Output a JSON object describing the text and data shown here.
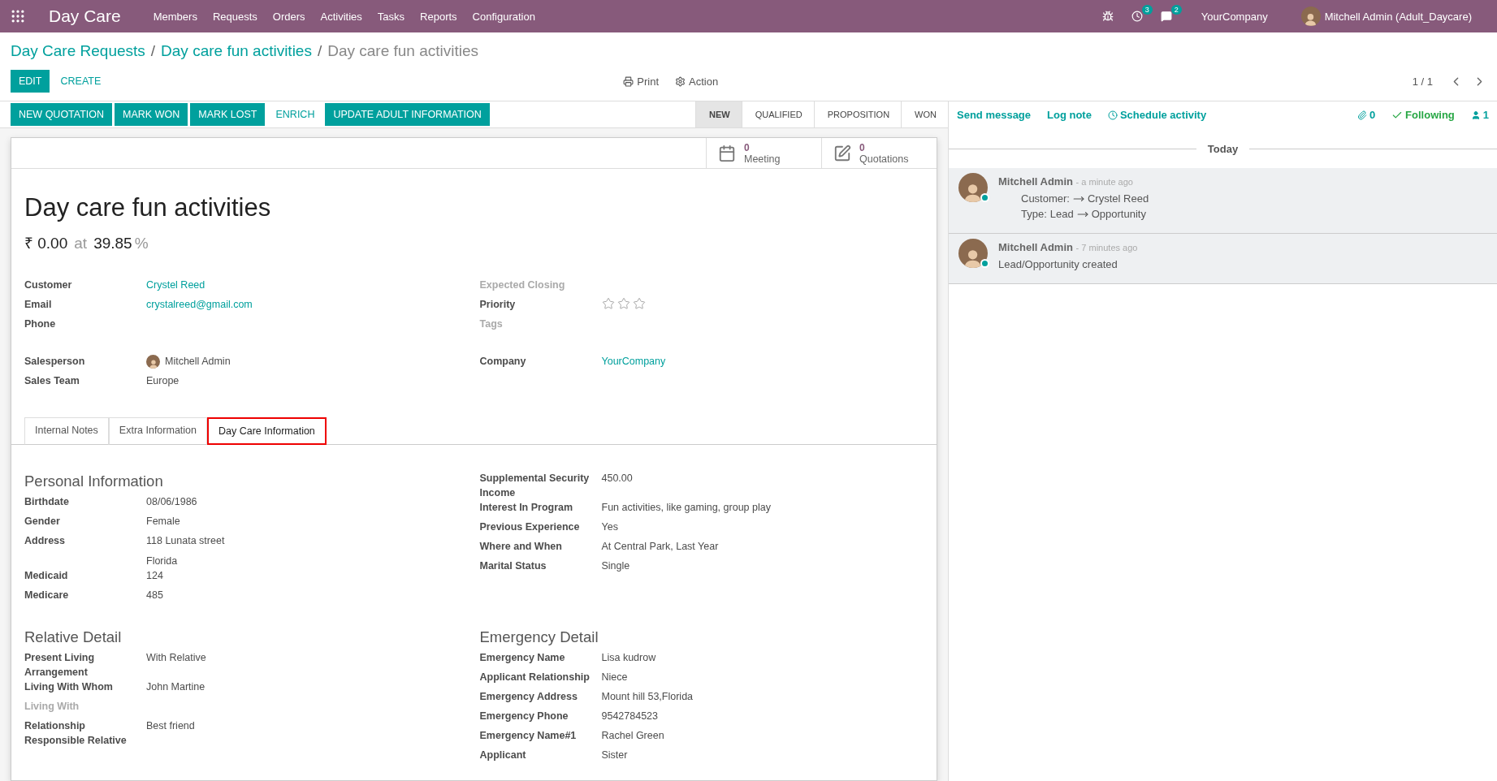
{
  "navbar": {
    "brand": "Day Care",
    "menu": [
      "Members",
      "Requests",
      "Orders",
      "Activities",
      "Tasks",
      "Reports",
      "Configuration"
    ],
    "activity_count": "3",
    "message_count": "2",
    "company": "YourCompany",
    "user": "Mitchell Admin (Adult_Daycare)"
  },
  "breadcrumbs": [
    {
      "label": "Day Care Requests",
      "link": true
    },
    {
      "separator": "/",
      "label": "Day care fun activities",
      "link": true
    },
    {
      "separator": "/",
      "label": "Day care fun activities",
      "link": false
    }
  ],
  "control_panel": {
    "buttons": [
      {
        "label": "EDIT",
        "kind": "primary"
      },
      {
        "label": "CREATE",
        "kind": "link"
      }
    ],
    "print": "Print",
    "action": "Action",
    "pager": "1 / 1"
  },
  "header_buttons": [
    {
      "label": "NEW QUOTATION",
      "kind": "primary"
    },
    {
      "label": "MARK WON",
      "kind": "primary"
    },
    {
      "label": "MARK LOST",
      "kind": "primary"
    },
    {
      "label": "ENRICH",
      "kind": "link"
    },
    {
      "label": "UPDATE ADULT INFORMATION",
      "kind": "primary"
    }
  ],
  "stages": [
    {
      "label": "NEW",
      "selected": true
    },
    {
      "label": "QUALIFIED",
      "selected": false
    },
    {
      "label": "PROPOSITION",
      "selected": false
    },
    {
      "label": "WON",
      "selected": false
    }
  ],
  "smart_buttons": [
    {
      "kind": "calendar",
      "count": "0",
      "label": "Meeting"
    },
    {
      "kind": "edit",
      "count": "0",
      "label": "Quotations"
    }
  ],
  "title": "Day care fun activities",
  "revenue": {
    "amount": "₹ 0.00",
    "at": "at",
    "probability": "39.85",
    "unit": "%"
  },
  "main_fields": [
    [
      {
        "label": "Customer",
        "value": "Crystel Reed",
        "kind": "link",
        "muted": false
      },
      {
        "label": "Email",
        "value": "crystalreed@gmail.com",
        "kind": "link",
        "muted": false
      },
      {
        "label": "Phone",
        "kind": "text",
        "muted": false
      },
      {
        "kind": "gap"
      },
      {
        "label": "Salesperson",
        "value": "Mitchell Admin",
        "kind": "avatar",
        "muted": false
      },
      {
        "label": "Sales Team",
        "value": "Europe",
        "kind": "text",
        "muted": false
      }
    ],
    [
      {
        "label": "Expected Closing",
        "kind": "text",
        "muted": true
      },
      {
        "label": "Priority",
        "kind": "stars",
        "stars": 0,
        "muted": false
      },
      {
        "label": "Tags",
        "kind": "text",
        "muted": true
      },
      {
        "kind": "gap"
      },
      {
        "label": "Company",
        "value": "YourCompany",
        "kind": "link",
        "muted": false
      }
    ]
  ],
  "tabs": [
    {
      "label": "Internal Notes",
      "selected": false
    },
    {
      "label": "Extra Information",
      "selected": false
    },
    {
      "label": "Day Care Information",
      "selected": true
    }
  ],
  "sections": [
    {
      "title": "Personal Information",
      "rows": [
        {
          "label": "Birthdate",
          "values": [
            "08/06/1986"
          ]
        },
        {
          "label": "Gender",
          "values": [
            "Female"
          ]
        },
        {
          "label": "Address",
          "values": [
            "118 Lunata street",
            "Florida"
          ]
        },
        {
          "label": "Medicaid",
          "values": [
            "124"
          ]
        },
        {
          "label": "Medicare",
          "values": [
            "485"
          ]
        }
      ]
    },
    {
      "rows": [
        {
          "label": "Supplemental Security Income",
          "values": [
            "450.00"
          ]
        },
        {
          "label": "Interest In Program",
          "values": [
            "Fun activities, like gaming, group play"
          ]
        },
        {
          "label": "Previous Experience",
          "values": [
            "Yes"
          ]
        },
        {
          "label": "Where and When",
          "values": [
            "At Central Park, Last Year"
          ]
        },
        {
          "label": "Marital Status",
          "values": [
            "Single"
          ]
        }
      ]
    },
    {
      "title": "Relative Detail",
      "rows": [
        {
          "label": "Present Living Arrangement",
          "values": [
            "With Relative"
          ]
        },
        {
          "label": "Living With Whom",
          "values": [
            "John Martine"
          ]
        },
        {
          "label": "Living With",
          "values": [],
          "muted": true
        },
        {
          "label": "Relationship Responsible Relative",
          "values": [
            "Best friend"
          ]
        }
      ]
    },
    {
      "title": "Emergency Detail",
      "rows": [
        {
          "label": "Emergency Name",
          "values": [
            "Lisa kudrow"
          ]
        },
        {
          "label": "Applicant Relationship",
          "values": [
            "Niece"
          ]
        },
        {
          "label": "Emergency Address",
          "values": [
            "Mount hill 53,Florida"
          ]
        },
        {
          "label": "Emergency Phone",
          "values": [
            "9542784523"
          ]
        },
        {
          "label": "Emergency Name#1",
          "values": [
            "Rachel Green"
          ]
        },
        {
          "label": "Applicant",
          "values": [
            "Sister"
          ]
        }
      ]
    }
  ],
  "chatter": {
    "actions": [
      {
        "label": "Send message",
        "icon": false
      },
      {
        "label": "Log note",
        "icon": false
      },
      {
        "label": "Schedule activity",
        "icon": true
      }
    ],
    "attachments": "0",
    "following": "Following",
    "followers": "1",
    "date_separator": "Today",
    "messages": [
      {
        "author": "Mitchell Admin",
        "time": "- a minute ago",
        "online": true,
        "kind": "tracking",
        "changes": [
          {
            "field": "Customer:",
            "new": "Crystel Reed"
          },
          {
            "field": "Type:",
            "old": "Lead",
            "new": "Opportunity"
          }
        ]
      },
      {
        "author": "Mitchell Admin",
        "time": "- 7 minutes ago",
        "online": true,
        "kind": "text",
        "body": "Lead/Opportunity created"
      }
    ]
  }
}
